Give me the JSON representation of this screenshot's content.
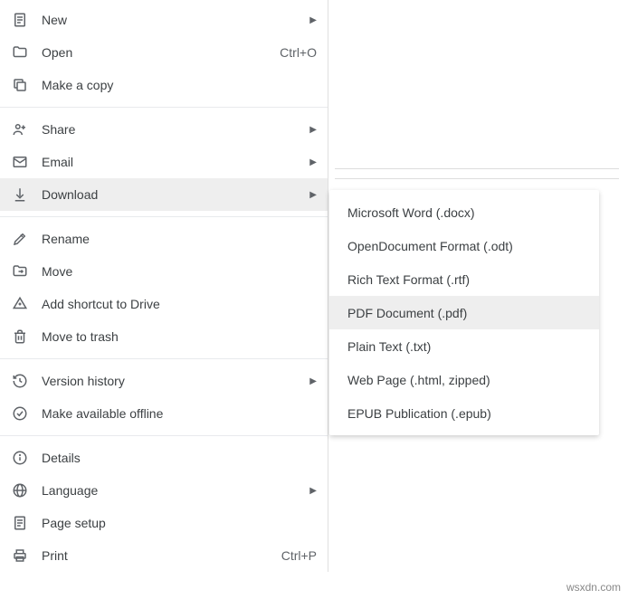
{
  "menu": {
    "new": "New",
    "open": "Open",
    "open_shortcut": "Ctrl+O",
    "make_copy": "Make a copy",
    "share": "Share",
    "email": "Email",
    "download": "Download",
    "rename": "Rename",
    "move": "Move",
    "add_shortcut": "Add shortcut to Drive",
    "move_to_trash": "Move to trash",
    "version_history": "Version history",
    "make_available_offline": "Make available offline",
    "details": "Details",
    "language": "Language",
    "page_setup": "Page setup",
    "print": "Print",
    "print_shortcut": "Ctrl+P"
  },
  "download_submenu": {
    "docx": "Microsoft Word (.docx)",
    "odt": "OpenDocument Format (.odt)",
    "rtf": "Rich Text Format (.rtf)",
    "pdf": "PDF Document (.pdf)",
    "txt": "Plain Text (.txt)",
    "html": "Web Page (.html, zipped)",
    "epub": "EPUB Publication (.epub)"
  },
  "watermark": "wsxdn.com"
}
